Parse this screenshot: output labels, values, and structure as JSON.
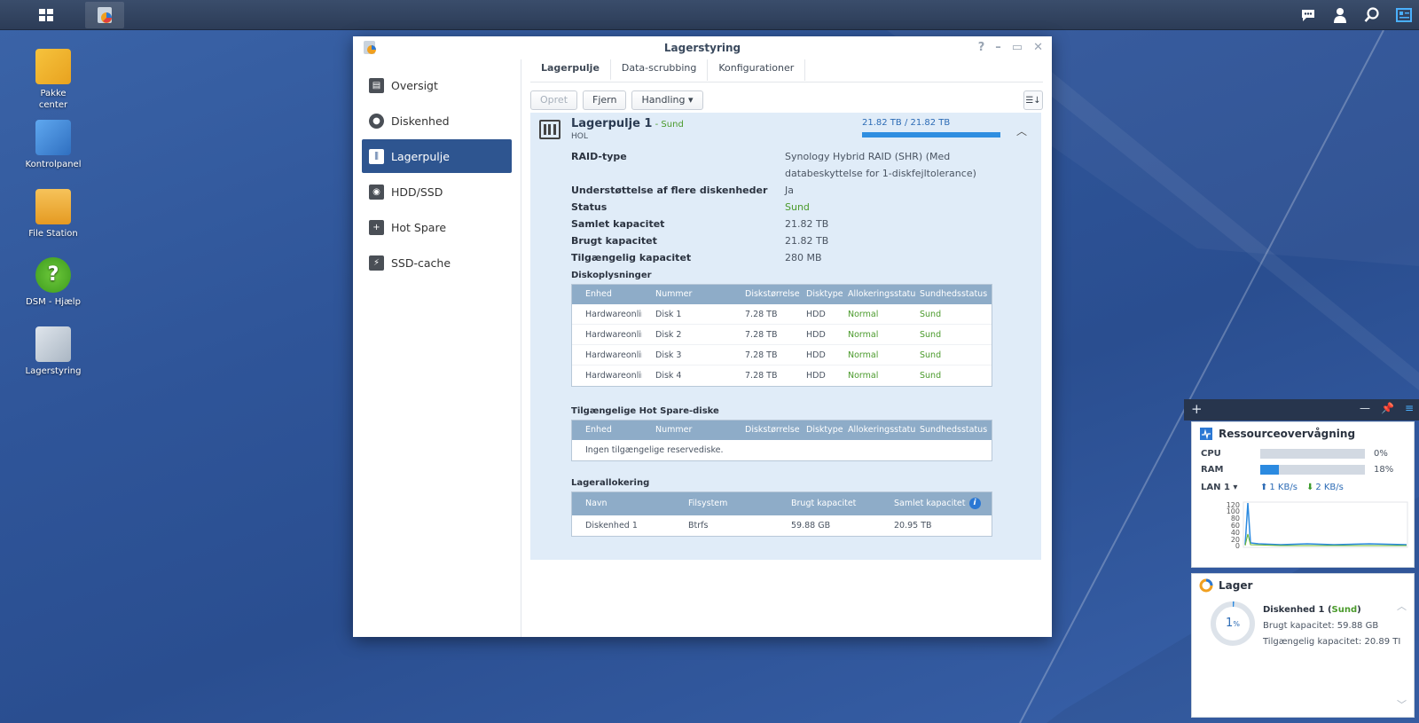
{
  "window": {
    "title": "Lagerstyring",
    "controls": [
      "?",
      "–",
      "▭",
      "✕"
    ]
  },
  "desktop": {
    "icons": [
      {
        "label_lines": [
          "Pakke",
          "center"
        ],
        "icon": "package-center-icon"
      },
      {
        "label_lines": [
          "Kontrolpanel"
        ],
        "icon": "control-panel-icon"
      },
      {
        "label_lines": [
          "File Station"
        ],
        "icon": "file-station-icon"
      },
      {
        "label_lines": [
          "DSM - Hjælp"
        ],
        "icon": "help-icon"
      },
      {
        "label_lines": [
          "Lagerstyring"
        ],
        "icon": "storage-manager-icon"
      }
    ]
  },
  "sidebar": {
    "items": [
      {
        "label": "Oversigt",
        "icon": "overview-icon"
      },
      {
        "label": "Diskenhed",
        "icon": "volume-icon"
      },
      {
        "label": "Lagerpulje",
        "icon": "storage-pool-icon"
      },
      {
        "label": "HDD/SSD",
        "icon": "hdd-icon"
      },
      {
        "label": "Hot Spare",
        "icon": "hot-spare-icon"
      },
      {
        "label": "SSD-cache",
        "icon": "ssd-cache-icon"
      }
    ],
    "active_index": 2
  },
  "tabs": [
    "Lagerpulje",
    "Data-scrubbing",
    "Konfigurationer"
  ],
  "toolbar": {
    "create": "Opret",
    "remove": "Fjern",
    "action": "Handling ▾"
  },
  "pool": {
    "name": "Lagerpulje 1",
    "status_suffix": " - Sund",
    "type": "HOL",
    "capacity_label": "21.82 TB / 21.82 TB",
    "capacity_fraction": 1.0,
    "props": [
      {
        "key": "RAID-type",
        "value": "Synology Hybrid RAID (SHR) (Med",
        "value2": "databeskyttelse for 1-diskfejltolerance)"
      },
      {
        "key": "Understøttelse af flere diskenheder",
        "value": "Ja"
      },
      {
        "key": "Status",
        "value": "Sund"
      },
      {
        "key": "Samlet kapacitet",
        "value": "21.82 TB"
      },
      {
        "key": "Brugt kapacitet",
        "value": "21.82 TB"
      },
      {
        "key": "Tilgængelig kapacitet",
        "value": "280 MB"
      }
    ]
  },
  "disk_info": {
    "title": "Diskoplysninger",
    "headers": [
      "Enhed",
      "Nummer",
      "Diskstørrelse",
      "Disktype",
      "Allokeringsstatus",
      "Sundhedsstatus"
    ],
    "rows": [
      [
        "Hardwareonline",
        "Disk 1",
        "7.28 TB",
        "HDD",
        "Normal",
        "Sund"
      ],
      [
        "Hardwareonline",
        "Disk 2",
        "7.28 TB",
        "HDD",
        "Normal",
        "Sund"
      ],
      [
        "Hardwareonline",
        "Disk 3",
        "7.28 TB",
        "HDD",
        "Normal",
        "Sund"
      ],
      [
        "Hardwareonline",
        "Disk 4",
        "7.28 TB",
        "HDD",
        "Normal",
        "Sund"
      ]
    ]
  },
  "hot_spare": {
    "title": "Tilgængelige Hot Spare-diske",
    "headers": [
      "Enhed",
      "Nummer",
      "Diskstørrelse",
      "Disktype",
      "Allokeringsstatus",
      "Sundhedsstatus"
    ],
    "empty": "Ingen tilgængelige reservediske."
  },
  "allocation": {
    "title": "Lagerallokering",
    "headers": [
      "Navn",
      "Filsystem",
      "Brugt kapacitet",
      "Samlet kapacitet"
    ],
    "rows": [
      [
        "Diskenhed 1",
        "Btrfs",
        "59.88 GB",
        "20.95 TB"
      ]
    ]
  },
  "resource_widget": {
    "title": "Ressourceovervågning",
    "cpu_label": "CPU",
    "cpu_pct": "0%",
    "cpu_value": 0,
    "ram_label": "RAM",
    "ram_pct": "18%",
    "ram_value": 18,
    "lan_label": "LAN 1 ▾",
    "lan_up": "1 KB/s",
    "lan_down": "2 KB/s",
    "chart_ticks": [
      "120",
      "100",
      "80",
      "60",
      "40",
      "20",
      "0"
    ]
  },
  "storage_widget": {
    "title": "Lager",
    "percent": "1",
    "percent_unit": "%",
    "volume_name": "Diskenhed 1 (",
    "volume_status": "Sund",
    "volume_close": ")",
    "used": "Brugt kapacitet: 59.88 GB",
    "available": "Tilgængelig kapacitet: 20.89 TI"
  }
}
